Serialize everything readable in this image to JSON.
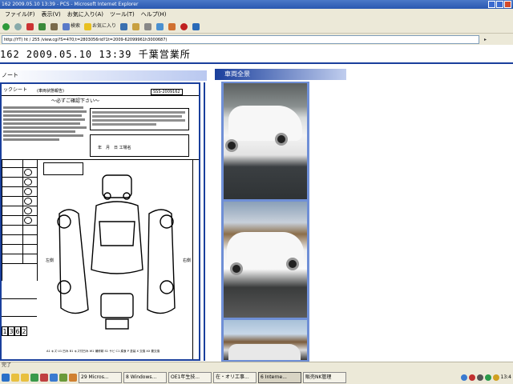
{
  "window": {
    "title": "162 2009.05.10 13:39 - PCS - Microsoft Internet Explorer"
  },
  "menu": [
    "ファイル(F)",
    "表示(V)",
    "お気に入り(A)",
    "ツール(T)",
    "ヘルプ(H)"
  ],
  "toolbar": {
    "search_label": "検索",
    "favorites_label": "お気に入り"
  },
  "address": {
    "url": "http://YT) ht / 255 /view.cgi?S=470;t=2803056rid?1t=2009-62099961h3000687)"
  },
  "page": {
    "title": "162 2009.05.10 13:39 千葉営業所",
    "sheet_heading": "ノート",
    "photos_heading": "車両全景"
  },
  "sheet": {
    "header_left": "ックシート",
    "header_note": "(車両状態報告)",
    "sheet_number": "SSS-2009162",
    "must_read": "〜必ずご確認下さい〜",
    "date_line": "年　月　日 工場名",
    "side_label_left": "左側",
    "side_label_right": "右側",
    "odometer_digits": [
      "1",
      "3",
      "6",
      "2"
    ],
    "legend": "A1 キズ U1 凹み B1 キズ付凹み W1 補修跡 S1 サビ C1 腐食 P 塗装 X 交換 XX 要交換"
  },
  "status_bar": {
    "text": "完了"
  },
  "taskbar": {
    "tasks": [
      "29 Micros...",
      "8 Windows...",
      "OE1年生技...",
      "在・オリ工事...",
      "6 Interne...",
      "販売NK管理"
    ],
    "active_task_index": 4,
    "clock": "13:4"
  },
  "colors": {
    "accent": "#1a3f9c",
    "title_bar": "#2a58b0",
    "chrome": "#ece9d8"
  }
}
